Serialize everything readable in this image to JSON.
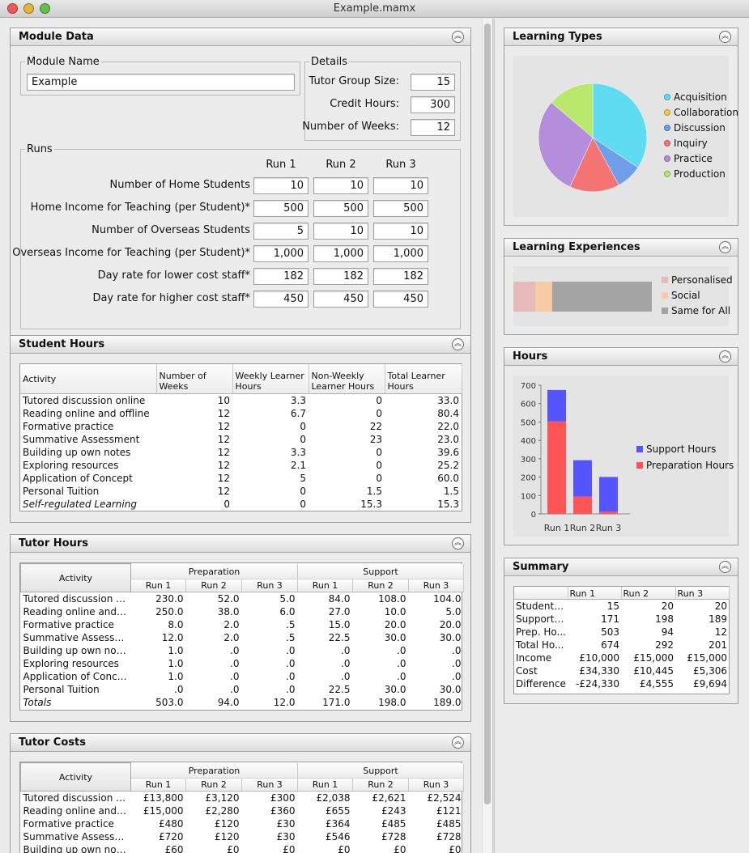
{
  "window": {
    "title": "Example.mamx"
  },
  "module_data": {
    "title": "Module Data",
    "module_name_legend": "Module Name",
    "module_name": "Example",
    "details_legend": "Details",
    "details": [
      {
        "label": "Tutor Group Size:",
        "value": "15"
      },
      {
        "label": "Credit Hours:",
        "value": "300"
      },
      {
        "label": "Number of Weeks:",
        "value": "12"
      }
    ],
    "runs_legend": "Runs",
    "run_headers": [
      "Run 1",
      "Run 2",
      "Run 3"
    ],
    "rows": [
      {
        "label": "Number of Home Students",
        "values": [
          "10",
          "10",
          "10"
        ]
      },
      {
        "label": "Home Income for Teaching (per Student)*",
        "values": [
          "500",
          "500",
          "500"
        ]
      },
      {
        "label": "Number of Overseas Students",
        "values": [
          "5",
          "10",
          "10"
        ]
      },
      {
        "label": "Overseas Income for Teaching (per Student)*",
        "values": [
          "1,000",
          "1,000",
          "1,000"
        ]
      },
      {
        "label": "Day rate for lower cost staff*",
        "values": [
          "182",
          "182",
          "182"
        ]
      },
      {
        "label": "Day rate for higher cost staff*",
        "values": [
          "450",
          "450",
          "450"
        ]
      }
    ]
  },
  "student_hours": {
    "title": "Student Hours",
    "headers": [
      "Activity",
      "Number of Weeks",
      "Weekly Learner Hours",
      "Non-Weekly Learner Hours",
      "Total Learner Hours"
    ],
    "rows": [
      [
        "Tutored discussion online",
        "10",
        "3.3",
        "0",
        "33.0"
      ],
      [
        "Reading online and offline",
        "12",
        "6.7",
        "0",
        "80.4"
      ],
      [
        "Formative practice",
        "12",
        "0",
        "22",
        "22.0"
      ],
      [
        "Summative Assessment",
        "12",
        "0",
        "23",
        "23.0"
      ],
      [
        "Building up own notes",
        "12",
        "3.3",
        "0",
        "39.6"
      ],
      [
        "Exploring resources",
        "12",
        "2.1",
        "0",
        "25.2"
      ],
      [
        "Application of Concept",
        "12",
        "5",
        "0",
        "60.0"
      ],
      [
        "Personal Tuition",
        "12",
        "0",
        "1.5",
        "1.5"
      ],
      [
        "Self-regulated Learning",
        "0",
        "0",
        "15.3",
        "15.3"
      ]
    ]
  },
  "tutor_hours": {
    "title": "Tutor Hours",
    "activity_header": "Activity",
    "group_headers": [
      "Preparation",
      "Support"
    ],
    "sub_headers": [
      "Run 1",
      "Run 2",
      "Run 3",
      "Run 1",
      "Run 2",
      "Run 3"
    ],
    "rows": [
      [
        "Tutored discussion o...",
        "230.0",
        "52.0",
        "5.0",
        "84.0",
        "108.0",
        "104.0"
      ],
      [
        "Reading online and ...",
        "250.0",
        "38.0",
        "6.0",
        "27.0",
        "10.0",
        "5.0"
      ],
      [
        "Formative practice",
        "8.0",
        "2.0",
        ".5",
        "15.0",
        "20.0",
        "20.0"
      ],
      [
        "Summative Assessm...",
        "12.0",
        "2.0",
        ".5",
        "22.5",
        "30.0",
        "30.0"
      ],
      [
        "Building up own notes",
        "1.0",
        ".0",
        ".0",
        ".0",
        ".0",
        ".0"
      ],
      [
        "Exploring resources",
        "1.0",
        ".0",
        ".0",
        ".0",
        ".0",
        ".0"
      ],
      [
        "Application of Concept",
        "1.0",
        ".0",
        ".0",
        ".0",
        ".0",
        ".0"
      ],
      [
        "Personal Tuition",
        ".0",
        ".0",
        ".0",
        "22.5",
        "30.0",
        "30.0"
      ],
      [
        "Totals",
        "503.0",
        "94.0",
        "12.0",
        "171.0",
        "198.0",
        "189.0"
      ]
    ]
  },
  "tutor_costs": {
    "title": "Tutor Costs",
    "activity_header": "Activity",
    "group_headers": [
      "Preparation",
      "Support"
    ],
    "sub_headers": [
      "Run 1",
      "Run 2",
      "Run 3",
      "Run 1",
      "Run 2",
      "Run 3"
    ],
    "rows": [
      [
        "Tutored discussion o...",
        "£13,800",
        "£3,120",
        "£300",
        "£2,038",
        "£2,621",
        "£2,524"
      ],
      [
        "Reading online and ...",
        "£15,000",
        "£2,280",
        "£360",
        "£655",
        "£243",
        "£121"
      ],
      [
        "Formative practice",
        "£480",
        "£120",
        "£30",
        "£364",
        "£485",
        "£485"
      ],
      [
        "Summative Assessm...",
        "£720",
        "£120",
        "£30",
        "£546",
        "£728",
        "£728"
      ],
      [
        "Building up own notes",
        "£60",
        "£0",
        "£0",
        "£0",
        "£0",
        "£0"
      ]
    ]
  },
  "learning_types": {
    "title": "Learning Types",
    "chart_data": {
      "type": "pie",
      "categories": [
        "Acquisition",
        "Collaboration",
        "Discussion",
        "Inquiry",
        "Practice",
        "Production"
      ],
      "values": [
        34.3,
        0,
        7.7,
        14.9,
        29.3,
        13.8
      ],
      "colors": [
        "#5fdcf2",
        "#f2c94c",
        "#6f9fe8",
        "#f47373",
        "#b48ddc",
        "#b8e86c"
      ]
    }
  },
  "learning_experiences": {
    "title": "Learning Experiences",
    "chart_data": {
      "type": "bar",
      "orientation": "horizontal-stacked",
      "categories": [
        "Personalised",
        "Social",
        "Same for All"
      ],
      "values": [
        16,
        12,
        72
      ],
      "colors": [
        "#e7b9b9",
        "#f7cba4",
        "#a4a4a4"
      ]
    }
  },
  "hours": {
    "title": "Hours",
    "chart_data": {
      "type": "bar",
      "stacked": true,
      "categories": [
        "Run 1",
        "Run 2",
        "Run 3"
      ],
      "series": [
        {
          "name": "Support Hours",
          "values": [
            171,
            198,
            189
          ],
          "color": "#5555ff"
        },
        {
          "name": "Preparation Hours",
          "values": [
            503,
            94,
            12
          ],
          "color": "#ff5555"
        }
      ],
      "ylim": [
        0,
        700
      ],
      "yticks": [
        "0",
        "100",
        "200",
        "300",
        "400",
        "500",
        "600",
        "700"
      ]
    }
  },
  "summary": {
    "title": "Summary",
    "headers": [
      "",
      "Run 1",
      "Run 2",
      "Run 3"
    ],
    "rows": [
      [
        "Student ...",
        "15",
        "20",
        "20"
      ],
      [
        "Support ...",
        "171",
        "198",
        "189"
      ],
      [
        "Prep. Ho...",
        "503",
        "94",
        "12"
      ],
      [
        "Total Ho...",
        "674",
        "292",
        "201"
      ],
      [
        "Income",
        "£10,000",
        "£15,000",
        "£15,000"
      ],
      [
        "Cost",
        "£34,330",
        "£10,445",
        "£5,306"
      ],
      [
        "Difference",
        "-£24,330",
        "£4,555",
        "£9,694"
      ]
    ]
  }
}
